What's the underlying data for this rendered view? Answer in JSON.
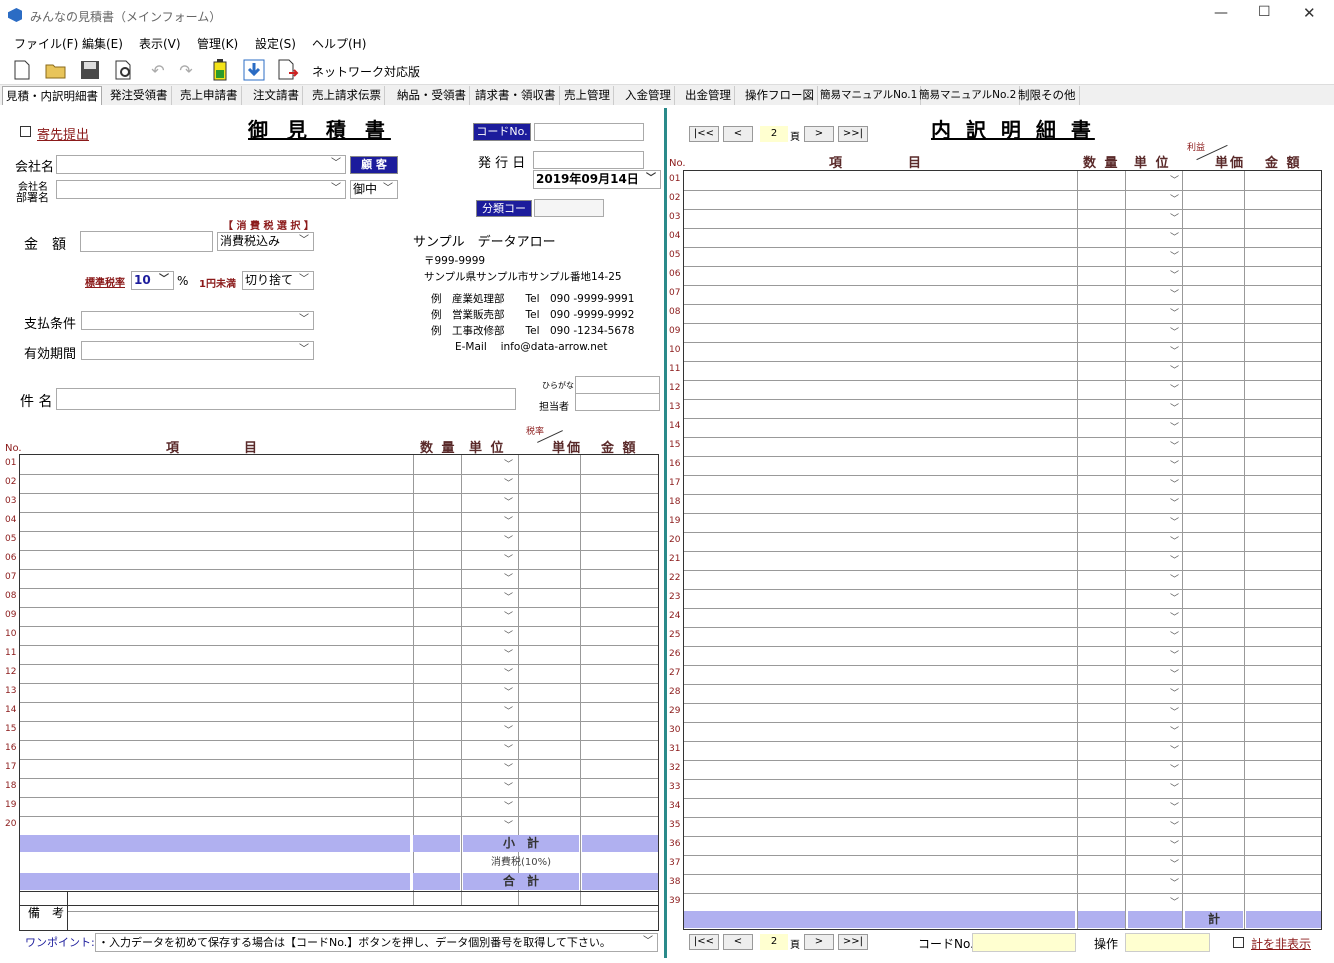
{
  "window": {
    "title": "みんなの見積書（メインフォーム）"
  },
  "menu": [
    "ファイル(F)",
    "編集(E)",
    "表示(V)",
    "管理(K)",
    "設定(S)",
    "ヘルプ(H)"
  ],
  "toolbar": {
    "network_label": "ネットワーク対応版"
  },
  "tabs": [
    "見積・内訳明細書",
    "発注受領書",
    "売上申請書",
    "注文請書",
    "売上請求伝票",
    "納品・受領書",
    "請求書・領収書",
    "売上管理",
    "入金管理",
    "出金管理",
    "操作フロー図",
    "簡易マニュアルNo.1",
    "簡易マニュアルNo.2",
    "制限その他"
  ],
  "left": {
    "send_link": "寄先提出",
    "doc_title": "御 見 積 書",
    "code_btn": "コードNo.",
    "issue_label": "発 行 日",
    "issue_date": "2019年09月14日",
    "class_btn": "分類コード",
    "company_label": "会社名",
    "customer_btn": "顧 客",
    "dept_label1": "会社名",
    "dept_label2": "部署名",
    "honorific": "御中",
    "tax_select_label": "【 消 費 税 選 択 】",
    "tax_mode": "消費税込み",
    "amount_label": "金　額",
    "std_rate_label": "標準税率",
    "rate_value": "10",
    "percent": "%",
    "rounding_label": "1円未満",
    "rounding": "切り捨て",
    "pay_label": "支払条件",
    "valid_label": "有効期間",
    "subject_label": "件 名",
    "hiragana_label": "ひらがな",
    "staff_label": "担当者",
    "company": {
      "name": "サンプル　データアロー",
      "zip": "〒999-9999",
      "addr": "サンプル県サンプル市サンプル番地14-25",
      "line1": "例　産業処理部　　Tel　090 -9999-9991",
      "line2": "例　営業販売部　　Tel　090 -9999-9992",
      "line3": "例　工事改修部　　Tel　090 -1234-5678",
      "email": "E-Mail　 info@data-arrow.net"
    },
    "col_no": "No.",
    "col_item1": "項",
    "col_item2": "目",
    "col_qty": "数 量",
    "col_unit": "単 位",
    "col_taxrate": "税率",
    "col_price": "単価",
    "col_amount": "金 額",
    "subtotal": "小　計",
    "tax": "消費税(10%)",
    "total": "合　計",
    "remarks": "備　考",
    "hint_label": "ワンポイント:",
    "hint_text": "・入力データを初めて保存する場合は【コードNo.】ボタンを押し、データ個別番号を取得して下さい。"
  },
  "right": {
    "doc_title": "内 訳 明 細 書",
    "page": "2",
    "page_suffix": "頁",
    "nav_first": "|<<",
    "nav_prev": "<",
    "nav_next": ">",
    "nav_last": ">>|",
    "col_no": "No.",
    "col_item1": "項",
    "col_item2": "目",
    "col_qty": "数 量",
    "col_unit": "単 位",
    "col_profit": "利益",
    "col_price": "単価",
    "col_amount": "金 額",
    "total": "計",
    "code_label": "コードNo.",
    "op_label": "操作",
    "hide_total": "計を非表示"
  }
}
